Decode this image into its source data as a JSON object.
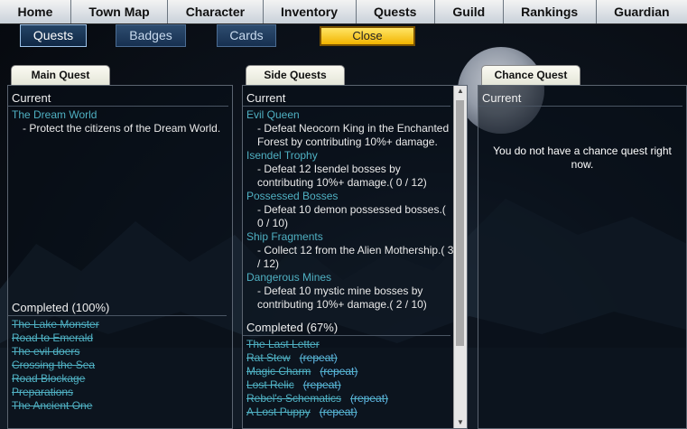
{
  "nav": [
    "Home",
    "Town Map",
    "Character",
    "Inventory",
    "Quests",
    "Guild",
    "Rankings",
    "Guardian"
  ],
  "tabs": {
    "quests": "Quests",
    "badges": "Badges",
    "cards": "Cards",
    "close": "Close"
  },
  "main_quest": {
    "header": "Main Quest",
    "current_title": "Current",
    "quest_name": "The Dream World",
    "quest_desc": "- Protect the citizens of the Dream World.",
    "completed_title": "Completed   (100%)",
    "completed": [
      "The Lake Monster",
      "Road to Emerald",
      "The evil doers",
      "Crossing the Sea",
      "Road Blockage",
      "Preparations",
      "The Ancient One"
    ]
  },
  "side_quests": {
    "header": "Side Quests",
    "current_title": "Current",
    "quests": [
      {
        "name": "Evil Queen",
        "desc": "- Defeat Neocorn King in the Enchanted Forest by contributing 10%+ damage."
      },
      {
        "name": "Isendel Trophy",
        "desc": "- Defeat 12 Isendel bosses by contributing 10%+ damage.( 0 / 12)"
      },
      {
        "name": "Possessed Bosses",
        "desc": "- Defeat 10 demon possessed bosses.( 0 / 10)"
      },
      {
        "name": "Ship Fragments",
        "desc": "- Collect 12 from the Alien Mothership.( 3 / 12)"
      },
      {
        "name": "Dangerous Mines",
        "desc": "- Defeat 10 mystic mine bosses by contributing 10%+ damage.( 2 / 10)"
      }
    ],
    "completed_title": "Completed   (67%)",
    "completed": [
      {
        "name": "The Last Letter",
        "repeat": ""
      },
      {
        "name": "Rat Stew",
        "repeat": "(repeat)"
      },
      {
        "name": "Magic Charm",
        "repeat": "(repeat)"
      },
      {
        "name": "Lost Relic",
        "repeat": "(repeat)"
      },
      {
        "name": "Rebel's Schematics",
        "repeat": "(repeat)"
      },
      {
        "name": "A Lost Puppy",
        "repeat": "(repeat)"
      }
    ]
  },
  "chance_quest": {
    "header": "Chance Quest",
    "current_title": "Current",
    "empty_message": "You do not have a chance quest right now."
  },
  "icons": {
    "scroll_up": "scroll-up-arrow-icon",
    "scroll_down": "scroll-down-arrow-icon"
  }
}
